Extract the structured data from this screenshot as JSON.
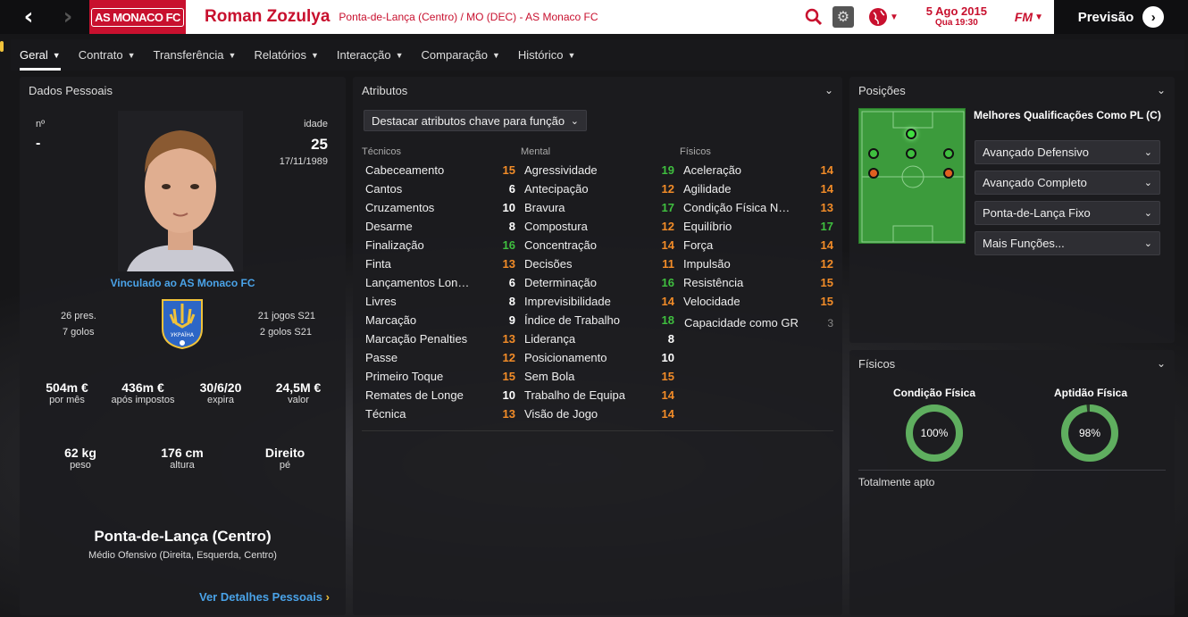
{
  "header": {
    "back_icon": "chevron-left-icon",
    "forward_icon": "chevron-right-icon",
    "club_crest_text": "AS MONACO FC",
    "player_name": "Roman Zozulya",
    "player_subtitle": "Ponta-de-Lança (Centro) / MO (DEC) - AS Monaco FC",
    "date_line1": "5 Ago 2015",
    "date_line2": "Qua 19:30",
    "fm_label": "FM",
    "preview_label": "Previsão",
    "accent_color": "#c8102e"
  },
  "tabs": [
    {
      "label": "Geral"
    },
    {
      "label": "Contrato"
    },
    {
      "label": "Transferência"
    },
    {
      "label": "Relatórios"
    },
    {
      "label": "Interacção"
    },
    {
      "label": "Comparação"
    },
    {
      "label": "Histórico"
    }
  ],
  "personal": {
    "title": "Dados Pessoais",
    "number_label": "nº",
    "number_value": "-",
    "age_label": "idade",
    "age_value": "25",
    "dob": "17/11/1989",
    "linked_to": "Vinculado ao AS Monaco FC",
    "caps": "26 pres.",
    "goals": "7 golos",
    "u21_caps": "21 jogos S21",
    "u21_goals": "2 golos S21",
    "national_badge_text": "УКРАЇНА",
    "stats": [
      {
        "value": "504m €",
        "label": "por mês"
      },
      {
        "value": "436m €",
        "label": "após impostos"
      },
      {
        "value": "30/6/20",
        "label": "expira"
      },
      {
        "value": "24,5M €",
        "label": "valor"
      }
    ],
    "body": [
      {
        "value": "62 kg",
        "label": "peso"
      },
      {
        "value": "176 cm",
        "label": "altura"
      },
      {
        "value": "Direito",
        "label": "pé"
      }
    ],
    "position_main": "Ponta-de-Lança (Centro)",
    "position_other": "Médio Ofensivo (Direita, Esquerda, Centro)",
    "details_link": "Ver Detalhes Pessoais"
  },
  "attributes": {
    "title": "Atributos",
    "highlight_dropdown": "Destacar atributos chave para função",
    "technical_header": "Técnicos",
    "mental_header": "Mental",
    "physical_header": "Físicos",
    "technical": [
      {
        "name": "Cabeceamento",
        "value": "15",
        "color": "orange"
      },
      {
        "name": "Cantos",
        "value": "6",
        "color": "white"
      },
      {
        "name": "Cruzamentos",
        "value": "10",
        "color": "white"
      },
      {
        "name": "Desarme",
        "value": "8",
        "color": "white"
      },
      {
        "name": "Finalização",
        "value": "16",
        "color": "green"
      },
      {
        "name": "Finta",
        "value": "13",
        "color": "orange"
      },
      {
        "name": "Lançamentos Lon…",
        "value": "6",
        "color": "white"
      },
      {
        "name": "Livres",
        "value": "8",
        "color": "white"
      },
      {
        "name": "Marcação",
        "value": "9",
        "color": "white"
      },
      {
        "name": "Marcação Penalties",
        "value": "13",
        "color": "orange"
      },
      {
        "name": "Passe",
        "value": "12",
        "color": "orange"
      },
      {
        "name": "Primeiro Toque",
        "value": "15",
        "color": "orange"
      },
      {
        "name": "Remates de Longe",
        "value": "10",
        "color": "white"
      },
      {
        "name": "Técnica",
        "value": "13",
        "color": "orange"
      }
    ],
    "mental": [
      {
        "name": "Agressividade",
        "value": "19",
        "color": "green"
      },
      {
        "name": "Antecipação",
        "value": "12",
        "color": "orange"
      },
      {
        "name": "Bravura",
        "value": "17",
        "color": "green"
      },
      {
        "name": "Compostura",
        "value": "12",
        "color": "orange"
      },
      {
        "name": "Concentração",
        "value": "14",
        "color": "orange"
      },
      {
        "name": "Decisões",
        "value": "11",
        "color": "orange"
      },
      {
        "name": "Determinação",
        "value": "16",
        "color": "green"
      },
      {
        "name": "Imprevisibilidade",
        "value": "14",
        "color": "orange"
      },
      {
        "name": "Índice de Trabalho",
        "value": "18",
        "color": "green"
      },
      {
        "name": "Liderança",
        "value": "8",
        "color": "white"
      },
      {
        "name": "Posicionamento",
        "value": "10",
        "color": "white"
      },
      {
        "name": "Sem Bola",
        "value": "15",
        "color": "orange"
      },
      {
        "name": "Trabalho de Equipa",
        "value": "14",
        "color": "orange"
      },
      {
        "name": "Visão de Jogo",
        "value": "14",
        "color": "orange"
      }
    ],
    "physical": [
      {
        "name": "Aceleração",
        "value": "14",
        "color": "orange"
      },
      {
        "name": "Agilidade",
        "value": "14",
        "color": "orange"
      },
      {
        "name": "Condição Física N…",
        "value": "13",
        "color": "orange"
      },
      {
        "name": "Equilíbrio",
        "value": "17",
        "color": "green"
      },
      {
        "name": "Força",
        "value": "14",
        "color": "orange"
      },
      {
        "name": "Impulsão",
        "value": "12",
        "color": "orange"
      },
      {
        "name": "Resistência",
        "value": "15",
        "color": "orange"
      },
      {
        "name": "Velocidade",
        "value": "15",
        "color": "orange"
      }
    ],
    "gk_label": "Capacidade como GR",
    "gk_value": "3"
  },
  "positions": {
    "title": "Posições",
    "best_roles_label": "Melhores Qualificações Como PL (C)",
    "roles": [
      "Avançado Defensivo",
      "Avançado Completo",
      "Ponta-de-Lança Fixo",
      "Mais Funções..."
    ]
  },
  "physical_panel": {
    "title": "Físicos",
    "condition_label": "Condição Física",
    "condition_value": "100%",
    "condition_fraction": 1.0,
    "fitness_label": "Aptidão Física",
    "fitness_value": "98%",
    "fitness_fraction": 0.98,
    "status": "Totalmente apto"
  }
}
